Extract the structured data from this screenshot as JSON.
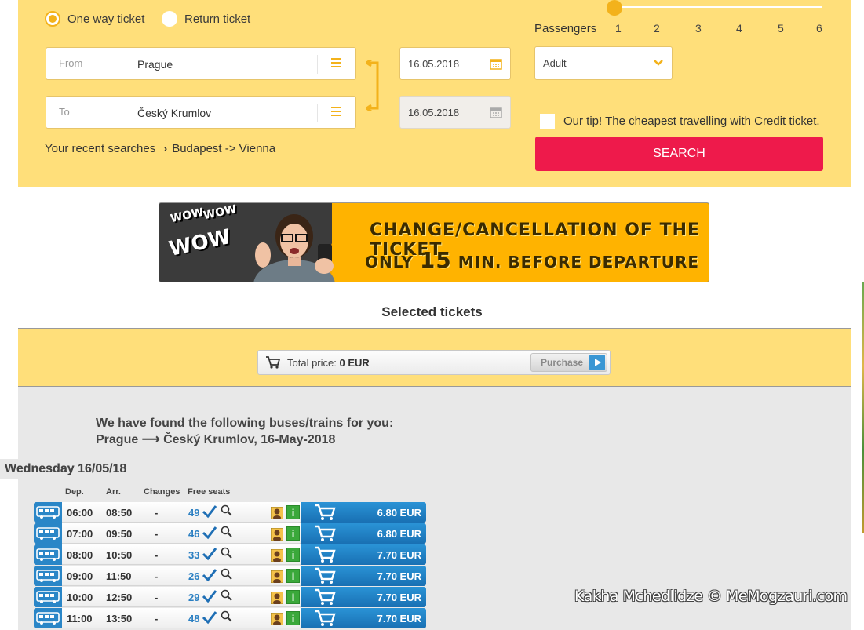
{
  "trip_type": {
    "one_way": "One way ticket",
    "return": "Return ticket"
  },
  "from": {
    "label": "From",
    "value": "Prague"
  },
  "to": {
    "label": "To",
    "value": "Český Krumlov"
  },
  "dates": {
    "depart": "16.05.2018",
    "return": "16.05.2018"
  },
  "recent": {
    "label": "Your recent searches",
    "route": "Budapest -> Vienna"
  },
  "passengers": {
    "label": "Passengers",
    "counts": [
      "1",
      "2",
      "3",
      "4",
      "5",
      "6"
    ],
    "selected": "1",
    "type": "Adult"
  },
  "tip": "Our tip! The cheapest travelling with Credit ticket.",
  "search_button": "SEARCH",
  "banner": {
    "wow1": "WOW",
    "wow2": "WOW",
    "wow3": "WOW",
    "line1": "CHANGE/CANCELLATION OF THE TICKET",
    "line2_pre": "ONLY",
    "line2_num": "15",
    "line2_post": "MIN. BEFORE DEPARTURE"
  },
  "selected_title": "Selected tickets",
  "basket": {
    "label": "Total price:",
    "value": "0 EUR",
    "button": "Purchase"
  },
  "found": "We have found the following buses/trains for you: Prague ⟶ Český Krumlov, 16-May-2018",
  "day": "Wednesday 16/05/18",
  "columns": {
    "dep": "Dep.",
    "arr": "Arr.",
    "changes": "Changes",
    "seats": "Free seats"
  },
  "rows": [
    {
      "dep": "06:00",
      "arr": "08:50",
      "changes": "-",
      "seats": "49",
      "price": "6.80 EUR"
    },
    {
      "dep": "07:00",
      "arr": "09:50",
      "changes": "-",
      "seats": "46",
      "price": "6.80 EUR"
    },
    {
      "dep": "08:00",
      "arr": "10:50",
      "changes": "-",
      "seats": "33",
      "price": "7.70 EUR"
    },
    {
      "dep": "09:00",
      "arr": "11:50",
      "changes": "-",
      "seats": "26",
      "price": "7.70 EUR"
    },
    {
      "dep": "10:00",
      "arr": "12:50",
      "changes": "-",
      "seats": "29",
      "price": "7.70 EUR"
    },
    {
      "dep": "11:00",
      "arr": "13:50",
      "changes": "-",
      "seats": "48",
      "price": "7.70 EUR"
    }
  ],
  "watermark": "Kakha Mchedlidze © MeMogzauri.com",
  "colors": {
    "panel": "#ffdf7a",
    "accent": "#f3b21b",
    "search": "#ee1a4b",
    "buy": "#2a86c7"
  }
}
